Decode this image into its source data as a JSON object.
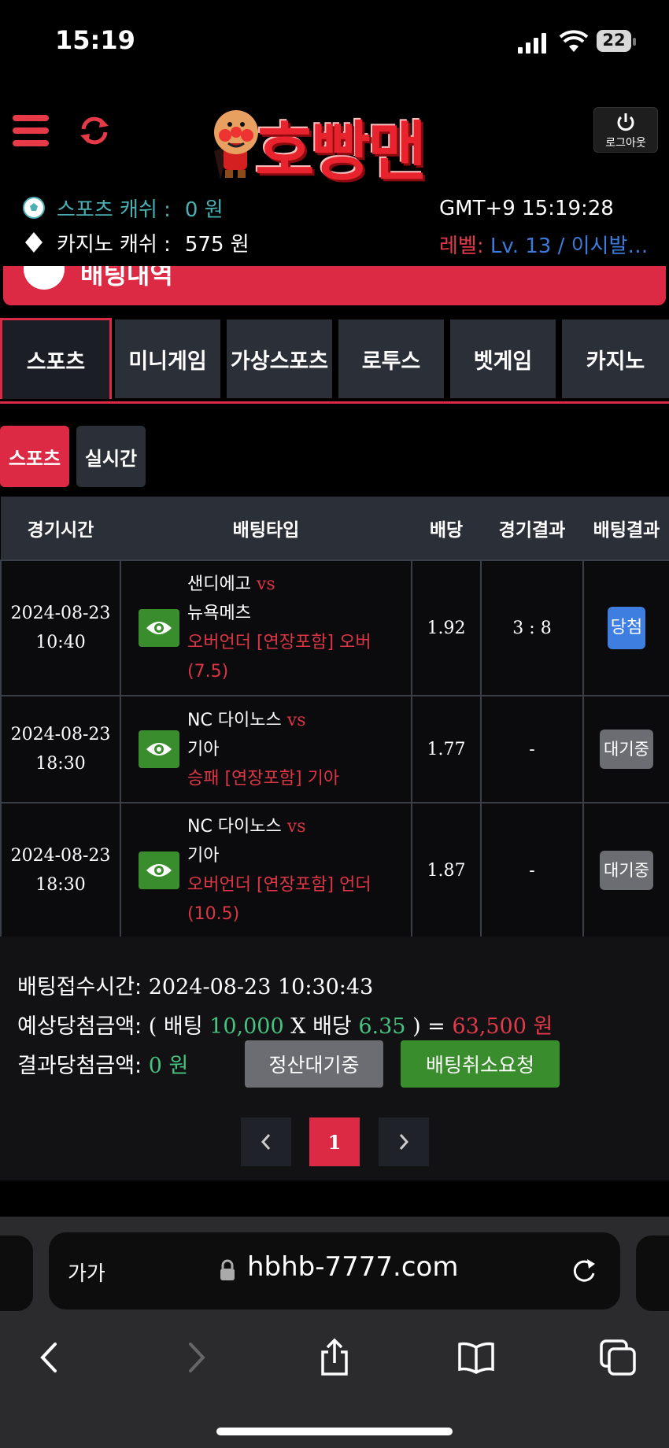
{
  "status_bar": {
    "time": "15:19",
    "battery": "22"
  },
  "header": {
    "logo_text": "호빵맨",
    "logout_label": "로그아웃",
    "sports_cash_label": "스포츠 캐쉬 :",
    "sports_cash_value": "0 원",
    "casino_cash_label": "카지노 캐쉬 :",
    "casino_cash_value": "575 원",
    "server_time": "GMT+9 15:19:28",
    "level_label": "레벨:",
    "level_value": "Lv. 13 / 이시발…"
  },
  "banner": {
    "title": "배팅내역"
  },
  "category_tabs": [
    "스포츠",
    "미니게임",
    "가상스포츠",
    "로투스",
    "벳게임",
    "카지노"
  ],
  "sub_tabs": [
    "스포츠",
    "실시간"
  ],
  "table": {
    "headers": [
      "경기시간",
      "배팅타입",
      "배당",
      "경기결과",
      "배팅결과"
    ],
    "rows": [
      {
        "date": "2024-08-23",
        "time": "10:40",
        "home": "샌디에고",
        "vs": "vs",
        "away": "뉴욕메츠",
        "pick": "오버언더 [연장포함] 오버",
        "pick_line": "(7.5)",
        "odds": "1.92",
        "score": "3 : 8",
        "result": "당첨"
      },
      {
        "date": "2024-08-23",
        "time": "18:30",
        "home": "NC 다이노스",
        "vs": "vs",
        "away": "기아",
        "pick": "승패 [연장포함] 기아",
        "pick_line": "",
        "odds": "1.77",
        "score": "-",
        "result": "대기중"
      },
      {
        "date": "2024-08-23",
        "time": "18:30",
        "home": "NC 다이노스",
        "vs": "vs",
        "away": "기아",
        "pick": "오버언더 [연장포함] 언더",
        "pick_line": "(10.5)",
        "odds": "1.87",
        "score": "-",
        "result": "대기중"
      }
    ]
  },
  "summary": {
    "bet_time_label": "배팅접수시간:",
    "bet_time_value": "2024-08-23 10:30:43",
    "expected_label": "예상당첨금액:",
    "open_paren": "(",
    "bet_word": "배팅",
    "bet_amount": "10,000",
    "times": "X",
    "odds_word": "배당",
    "total_odds": "6.35",
    "close_eq": ") =",
    "expected_amount": "63,500 원",
    "result_label": "결과당첨금액:",
    "result_value": "0 원",
    "settle_button": "정산대기중",
    "cancel_button": "배팅취소요청"
  },
  "pagination": {
    "prev": "‹",
    "current": "1",
    "next": "›"
  },
  "browser": {
    "text_size": "가가",
    "url": "hbhb-7777.com"
  },
  "colors": {
    "accent": "#dc2a45",
    "win_badge": "#3e7ee0",
    "green": "#46c281",
    "eye_button": "#3a8d2d"
  }
}
